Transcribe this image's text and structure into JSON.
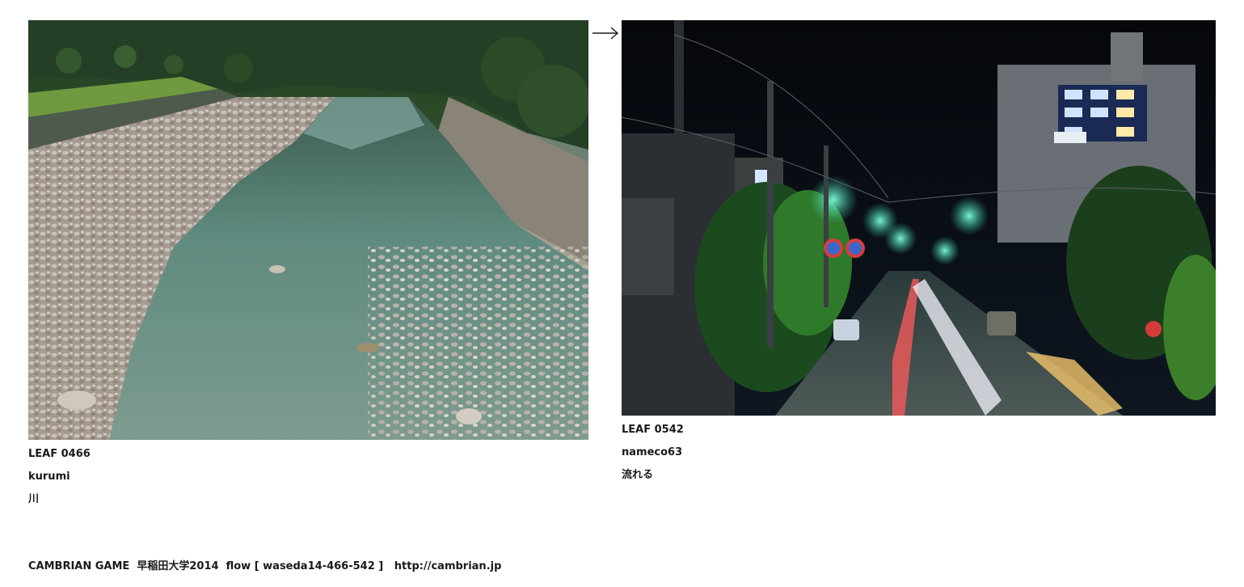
{
  "leaves": [
    {
      "id": "LEAF 0466",
      "author": "kurumi",
      "title": "川",
      "image_alt": "river-photo"
    },
    {
      "id": "LEAF 0542",
      "author": "nameco63",
      "title": "流れる",
      "image_alt": "night-street-photo"
    }
  ],
  "arrow_icon": "right-arrow-icon",
  "footer": {
    "text": "CAMBRIAN GAME  早稲田大学2014  flow [ waseda14-466-542 ]   ",
    "link": "http://cambrian.jp"
  },
  "colors": {
    "text": "#1a1a1a",
    "background": "#ffffff"
  }
}
